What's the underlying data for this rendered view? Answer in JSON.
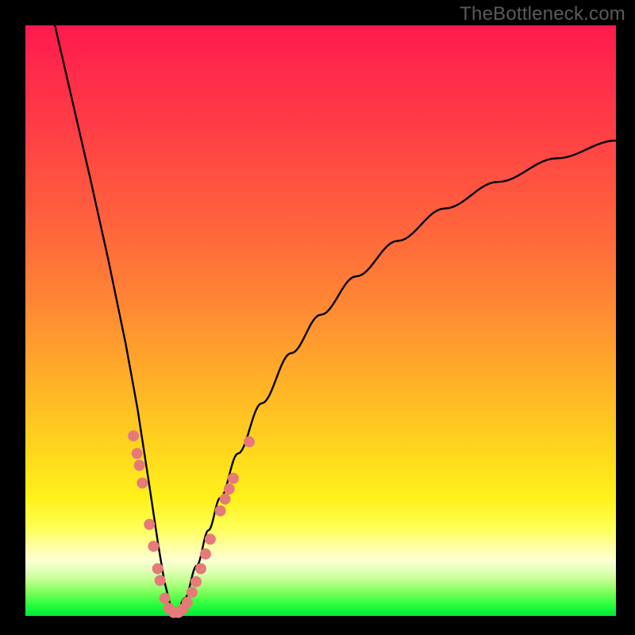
{
  "watermark": "TheBottleneck.com",
  "gradient_colors": {
    "top": "#ff1a4d",
    "mid_orange": "#ff8a33",
    "yellow": "#fff11a",
    "pale": "#fdffd2",
    "green": "#00e838"
  },
  "chart_data": {
    "type": "line",
    "title": "",
    "xlabel": "",
    "ylabel": "",
    "xlim": [
      0,
      100
    ],
    "ylim": [
      0,
      100
    ],
    "grid": false,
    "description": "V-shaped bottleneck curve: steep near-linear drop from top-left to a minimum near x≈24, then a concave-down rise toward the right edge. Salmon dot markers cluster along both branches in the lower ~30% of the plot.",
    "series": [
      {
        "name": "curve-left-branch",
        "x": [
          5,
          8,
          11,
          14,
          17,
          19,
          21,
          22.5,
          23.5,
          24.5,
          25.5
        ],
        "y": [
          100,
          87,
          74,
          60.5,
          46,
          35,
          22,
          12,
          6,
          2,
          0.5
        ],
        "stroke": "#000000"
      },
      {
        "name": "curve-right-branch",
        "x": [
          25.5,
          27,
          29,
          31,
          33,
          36,
          40,
          45,
          50,
          56,
          63,
          71,
          80,
          90,
          100
        ],
        "y": [
          0.5,
          3,
          8.5,
          14.5,
          20,
          27.5,
          36,
          44.5,
          51,
          57.5,
          63.5,
          69,
          73.5,
          77.5,
          80.5
        ],
        "stroke": "#000000"
      }
    ],
    "markers": {
      "name": "dots",
      "color": "#e67a78",
      "radius_px": 7,
      "points_xy": [
        [
          18.3,
          30.5
        ],
        [
          18.9,
          27.5
        ],
        [
          19.3,
          25.5
        ],
        [
          19.8,
          22.5
        ],
        [
          21.0,
          15.5
        ],
        [
          21.7,
          11.8
        ],
        [
          22.4,
          8.0
        ],
        [
          22.8,
          6.0
        ],
        [
          23.6,
          3.0
        ],
        [
          24.3,
          1.3
        ],
        [
          25.1,
          0.6
        ],
        [
          25.9,
          0.6
        ],
        [
          26.7,
          1.2
        ],
        [
          27.4,
          2.3
        ],
        [
          28.2,
          4.0
        ],
        [
          28.9,
          5.8
        ],
        [
          29.7,
          8.0
        ],
        [
          30.5,
          10.5
        ],
        [
          31.3,
          13.0
        ],
        [
          33.0,
          17.8
        ],
        [
          33.8,
          19.8
        ],
        [
          34.5,
          21.5
        ],
        [
          35.2,
          23.3
        ],
        [
          37.9,
          29.5
        ]
      ]
    }
  }
}
